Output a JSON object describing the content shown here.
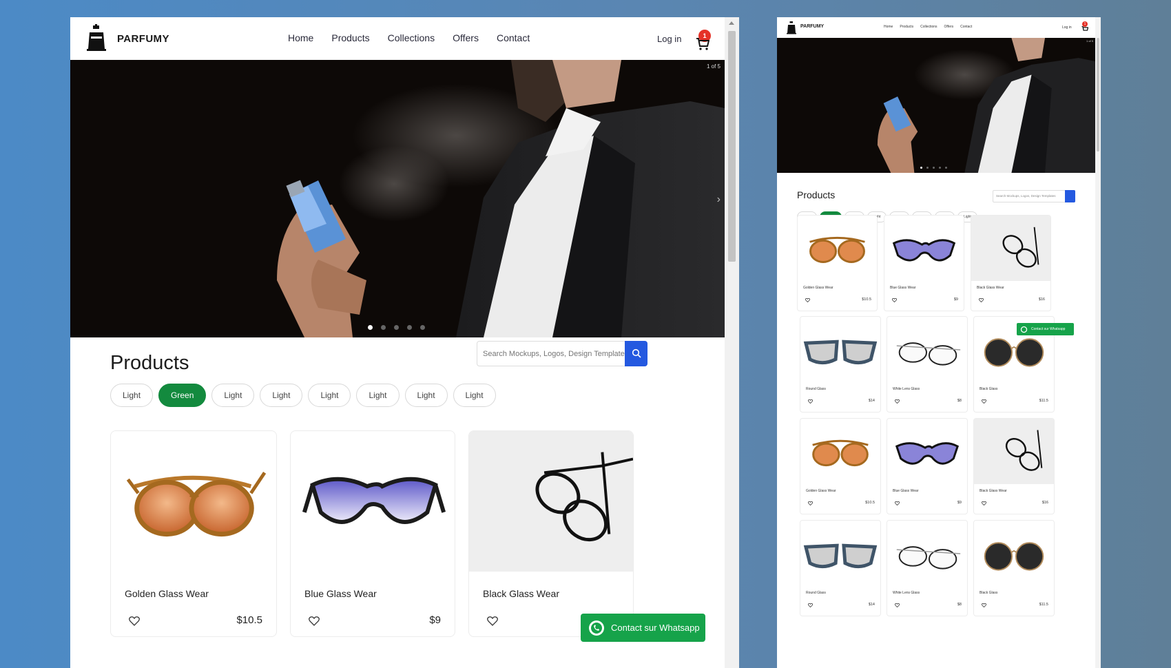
{
  "brand": {
    "name": "PARFUMY"
  },
  "nav": [
    "Home",
    "Products",
    "Collections",
    "Offers",
    "Contact"
  ],
  "header": {
    "login": "Log in",
    "cart_count": "1"
  },
  "hero": {
    "counter": "1 of 5",
    "slides": 5,
    "active": 0
  },
  "products": {
    "title": "Products",
    "search_placeholder": "Search Mockups, Logos, Design Templates",
    "filters": [
      "Light",
      "Green",
      "Light",
      "Light",
      "Light",
      "Light",
      "Light",
      "Light"
    ],
    "active_filter": 1,
    "items": [
      {
        "name": "Golden Glass Wear",
        "price": "$10.5"
      },
      {
        "name": "Blue Glass Wear",
        "price": "$9"
      },
      {
        "name": "Black Glass Wear",
        "price": "$16"
      },
      {
        "name": "Round Glass",
        "price": "$14"
      },
      {
        "name": "White Lens Glass",
        "price": "$8"
      },
      {
        "name": "Black Glass",
        "price": "$11.5"
      }
    ]
  },
  "whatsapp": {
    "label": "Contact sur Whatsapp"
  },
  "colors": {
    "accent_green": "#138a3e",
    "search_blue": "#2459e0",
    "badge_red": "#e53228"
  }
}
